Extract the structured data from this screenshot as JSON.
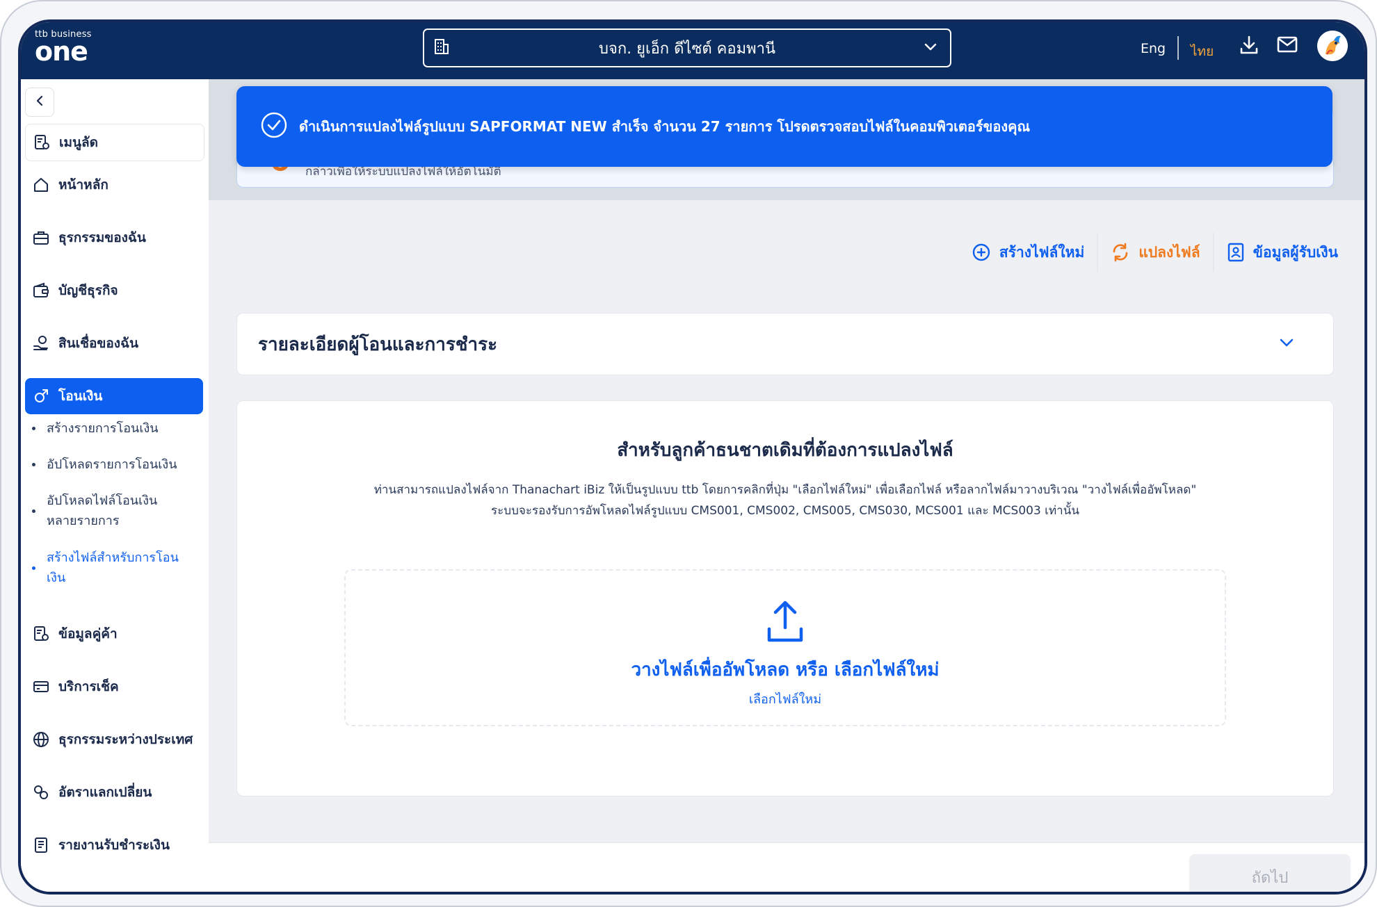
{
  "header": {
    "logo_small": "ttb business",
    "logo_big": "one",
    "company_name": "บจก. ยูเอ็ก ดีไซต์ คอมพานี",
    "lang_eng": "Eng",
    "lang_thai": "ไทย"
  },
  "sidebar": {
    "shortcut": "เมนูลัด",
    "items": [
      {
        "label": "หน้าหลัก",
        "icon": "home-icon"
      },
      {
        "label": "ธุรกรรมของฉัน",
        "icon": "briefcase-icon"
      },
      {
        "label": "บัญชีธุรกิจ",
        "icon": "wallet-icon"
      },
      {
        "label": "สินเชื่อของฉัน",
        "icon": "loan-icon"
      },
      {
        "label": "โอนเงิน",
        "icon": "transfer-icon"
      }
    ],
    "sub_items": [
      {
        "label": "สร้างรายการโอนเงิน"
      },
      {
        "label": "อัปโหลดรายการโอนเงิน"
      },
      {
        "label": "อัปโหลดไฟล์โอนเงินหลายรายการ"
      },
      {
        "label": "สร้างไฟล์สำหรับการโอนเงิน"
      }
    ],
    "items_bottom": [
      {
        "label": "ข้อมูลคู่ค้า",
        "icon": "partner-icon"
      },
      {
        "label": "บริการเช็ค",
        "icon": "cheque-icon"
      },
      {
        "label": "ธุรกรรมระหว่างประเทศ",
        "icon": "globe-icon"
      },
      {
        "label": "อัตราแลกเปลี่ยน",
        "icon": "exchange-icon"
      },
      {
        "label": "รายงานรับชำระเงิน",
        "icon": "report-icon"
      }
    ]
  },
  "toast": {
    "message": "ดำเนินการแปลงไฟล์รูปแบบ SAPFORMAT NEW สำเร็จ จำนวน 27 รายการ โปรดตรวจสอบไฟล์ในคอมพิวเตอร์ของคุณ"
  },
  "info_behind": {
    "text": "กล่าวเพื่อให้ระบบแปลงไฟล์ให้อัตโนมัติ"
  },
  "actions": {
    "create_file": "สร้างไฟล์ใหม่",
    "convert_file": "แปลงไฟล์",
    "payee_info": "ข้อมูลผู้รับเงิน"
  },
  "accordion": {
    "title": "รายละเอียดผู้โอนและการชำระ"
  },
  "upload": {
    "heading": "สำหรับลูกค้าธนชาตเดิมที่ต้องการแปลงไฟล์",
    "desc1": "ท่านสามารถแปลงไฟล์จาก Thanachart iBiz ให้เป็นรูปแบบ ttb โดยการคลิกที่ปุ่ม \"เลือกไฟล์ใหม่\" เพื่อเลือกไฟล์ หรือลากไฟล์มาวางบริเวณ \"วางไฟล์เพื่ออัพโหลด\"",
    "desc2": "ระบบจะรองรับการอัพโหลดไฟล์รูปแบบ CMS001, CMS002, CMS005, CMS030, MCS001 และ MCS003 เท่านั้น",
    "drop_text": "วางไฟล์เพื่ออัพโหลด หรือ เลือกไฟล์ใหม่",
    "select_link": "เลือกไฟล์ใหม่"
  },
  "footer": {
    "next": "ถัดไป"
  },
  "colors": {
    "navy": "#0b2c5e",
    "primary": "#0d5ff0",
    "orange": "#f07a1e",
    "lang_active": "#f6a63a"
  }
}
